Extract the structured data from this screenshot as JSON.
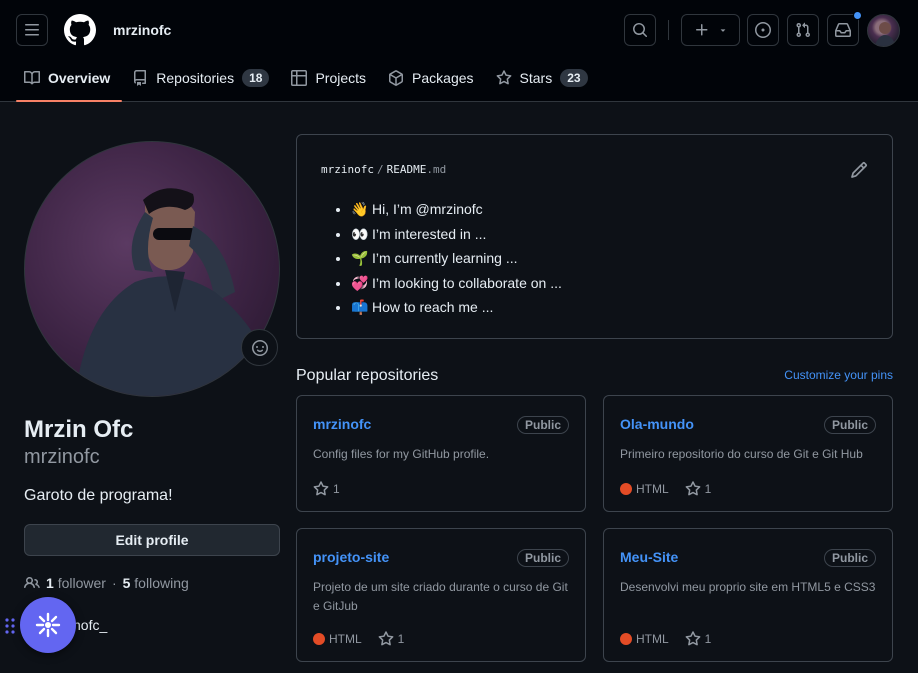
{
  "header": {
    "username": "mrzinofc",
    "icons": [
      "hamburger-icon",
      "github-logo-icon",
      "search-icon",
      "plus-icon",
      "issue-icon",
      "pull-request-icon",
      "inbox-icon"
    ]
  },
  "tabs": [
    {
      "label": "Overview",
      "active": true
    },
    {
      "label": "Repositories",
      "count": "18"
    },
    {
      "label": "Projects"
    },
    {
      "label": "Packages"
    },
    {
      "label": "Stars",
      "count": "23"
    }
  ],
  "profile": {
    "full_name": "Mrzin Ofc",
    "login": "mrzinofc",
    "bio": "Garoto de programa!",
    "edit_label": "Edit profile",
    "followers_count": "1",
    "followers_label": "follower",
    "separator": "·",
    "following_count": "5",
    "following_label": "following",
    "social_handle": "nofc_"
  },
  "readme": {
    "owner": "mrzinofc",
    "separator": "/",
    "file": "README",
    "ext": ".md",
    "items": [
      {
        "emoji": "👋",
        "text": "Hi, I’m @mrzinofc"
      },
      {
        "emoji": "👀",
        "text": "I’m interested in ..."
      },
      {
        "emoji": "🌱",
        "text": "I’m currently learning ..."
      },
      {
        "emoji": "💞️",
        "text": "I’m looking to collaborate on ..."
      },
      {
        "emoji": "📫",
        "text": "How to reach me ..."
      }
    ]
  },
  "popular": {
    "title": "Popular repositories",
    "customize_label": "Customize your pins",
    "repos": [
      {
        "name": "mrzinofc",
        "visibility": "Public",
        "description": "Config files for my GitHub profile.",
        "language": "",
        "stars": "1"
      },
      {
        "name": "Ola-mundo",
        "visibility": "Public",
        "description": "Primeiro repositorio do curso de Git e Git Hub",
        "language": "HTML",
        "stars": "1"
      },
      {
        "name": "projeto-site",
        "visibility": "Public",
        "description": "Projeto de um site criado durante o curso de Git e GitJub",
        "language": "HTML",
        "stars": "1"
      },
      {
        "name": "Meu-Site",
        "visibility": "Public",
        "description": "Desenvolvi meu proprio site em HTML5 e CSS3",
        "language": "HTML",
        "stars": "1"
      }
    ]
  },
  "colors": {
    "accent_link": "#4493f8",
    "tab_underline": "#f78166",
    "html_lang": "#e34c26",
    "fab": "#6366f1",
    "notification_dot": "#4493f8"
  }
}
